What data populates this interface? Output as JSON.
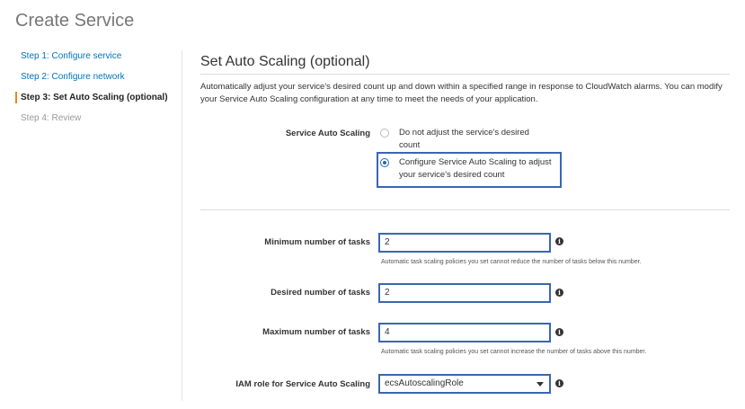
{
  "page": {
    "title": "Create Service"
  },
  "steps": [
    {
      "label": "Step 1: Configure service",
      "state": "link"
    },
    {
      "label": "Step 2: Configure network",
      "state": "link"
    },
    {
      "label": "Step 3: Set Auto Scaling (optional)",
      "state": "active"
    },
    {
      "label": "Step 4: Review",
      "state": "disabled"
    }
  ],
  "section": {
    "title": "Set Auto Scaling (optional)",
    "description": "Automatically adjust your service's desired count up and down within a specified range in response to CloudWatch alarms. You can modify your Service Auto Scaling configuration at any time to meet the needs of your application."
  },
  "auto_scaling": {
    "label": "Service Auto Scaling",
    "options": [
      {
        "text": "Do not adjust the service's desired count",
        "checked": false
      },
      {
        "text": "Configure Service Auto Scaling to adjust your service's desired count",
        "checked": true
      }
    ]
  },
  "fields": {
    "min_tasks": {
      "label": "Minimum number of tasks",
      "value": "2",
      "help": "Automatic task scaling policies you set cannot reduce the number of tasks below this number."
    },
    "desired_tasks": {
      "label": "Desired number of tasks",
      "value": "2"
    },
    "max_tasks": {
      "label": "Maximum number of tasks",
      "value": "4",
      "help": "Automatic task scaling policies you set cannot increase the number of tasks above this number."
    },
    "iam_role": {
      "label": "IAM role for Service Auto Scaling",
      "value": "ecsAutoscalingRole"
    }
  },
  "icons": {
    "info": "info-icon",
    "caret": "chevron-down-icon"
  },
  "colors": {
    "link": "#0073bb",
    "active_marker": "#e8891c",
    "highlight": "#3a66b0",
    "radio": "#1e6bb8"
  }
}
